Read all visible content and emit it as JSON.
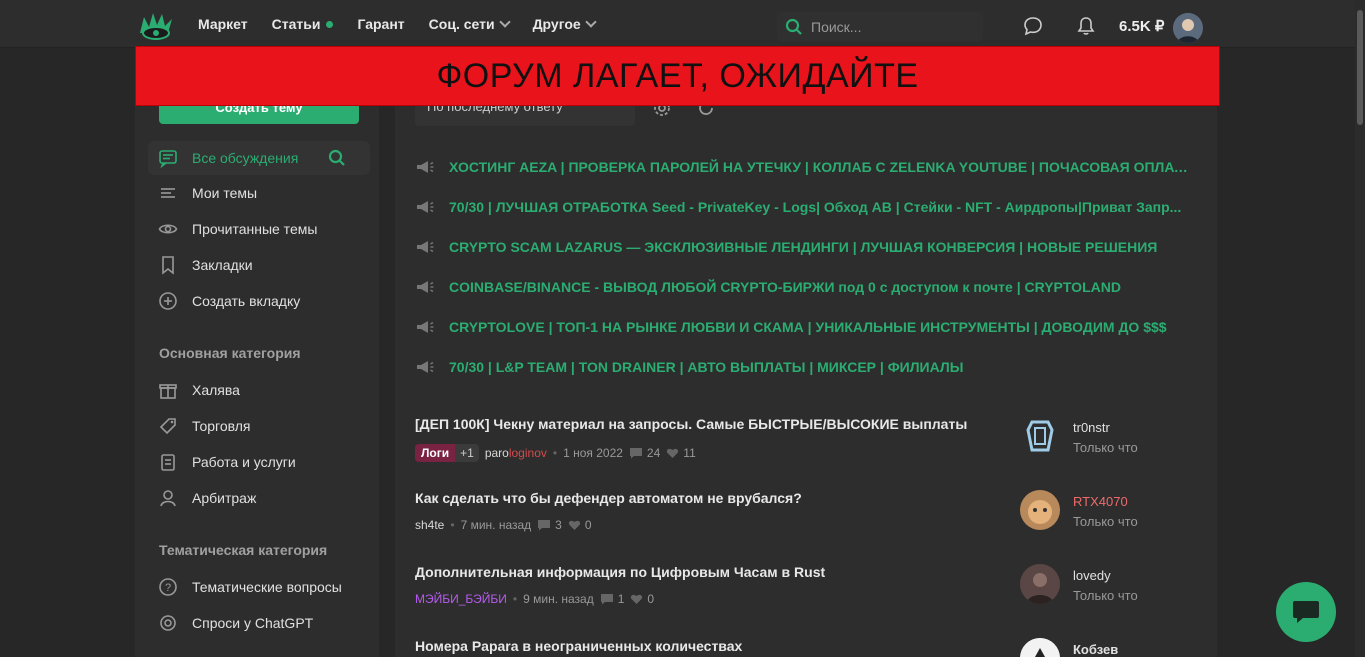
{
  "nav": {
    "items": [
      {
        "label": "Маркет"
      },
      {
        "label": "Статьи"
      },
      {
        "label": "Гарант"
      },
      {
        "label": "Соц. сети"
      },
      {
        "label": "Другое"
      }
    ],
    "search_placeholder": "Поиск...",
    "balance": "6.5K ₽"
  },
  "banner": {
    "text": "ФОРУМ ЛАГАЕТ, ОЖИДАЙТЕ"
  },
  "sidebar": {
    "create_button": "Создать тему",
    "items": [
      {
        "label": "Все обсуждения"
      },
      {
        "label": "Мои темы"
      },
      {
        "label": "Прочитанные темы"
      },
      {
        "label": "Закладки"
      },
      {
        "label": "Создать вкладку"
      }
    ],
    "section_main": "Основная категория",
    "main_items": [
      {
        "label": "Халява"
      },
      {
        "label": "Торговля"
      },
      {
        "label": "Работа и услуги"
      },
      {
        "label": "Арбитраж"
      }
    ],
    "section_thematic": "Тематическая категория",
    "thematic_items": [
      {
        "label": "Тематические вопросы"
      },
      {
        "label": "Спроси у ChatGPT"
      }
    ]
  },
  "main": {
    "sort_label": "По последнему ответу",
    "ads": [
      "ХОСТИНГ AEZA | ПРОВЕРКА ПАРОЛЕЙ НА УТЕЧКУ | КОЛЛАБ С ZELENKA YOUTUBE | ПОЧАСОВАЯ ОПЛАТА",
      "70/30 | ЛУЧШАЯ ОТРАБОТКА Seed - PrivateKey - Logs| Обход АВ | Стейки - NFT - Аирдропы|Приват Запр...",
      "CRYPTO SCAM LAZARUS — ЭКСКЛЮЗИВНЫЕ ЛЕНДИНГИ | ЛУЧШАЯ КОНВЕРСИЯ | НОВЫЕ РЕШЕНИЯ",
      "COINBASE/BINANCE - ВЫВОД ЛЮБОЙ CRYPTO-БИРЖИ под 0 с доступом к почте | CRYPTOLAND",
      "CRYPTOLOVE | ТОП-1 НА РЫНКЕ ЛЮБВИ И СКАМА | УНИКАЛЬНЫЕ ИНСТРУМЕНТЫ | ДОВОДИМ ДО $$$",
      "70/30 | L&P TEAM | TON DRAINER | АВТО ВЫПЛАТЫ | МИКСЕР | ФИЛИАЛЫ"
    ],
    "threads": [
      {
        "title": "[ДЕП 100К] Чекну материал на запросы. Самые БЫСТРЫЕ/ВЫСОКИЕ выплаты",
        "badge": "Логи",
        "badge_plus": "+1",
        "author_a": "paro",
        "author_b": "loginov",
        "time": "1 ноя 2022",
        "replies": "24",
        "likes": "11",
        "last_user": "tr0nstr",
        "last_time": "Только что"
      },
      {
        "title": "Как сделать что бы дефендер автоматом не врубался?",
        "author": "sh4te",
        "time": "7 мин. назад",
        "replies": "3",
        "likes": "0",
        "last_user": "RTX4070",
        "last_time": "Только что"
      },
      {
        "title": "Дополнительная информация по Цифровым Часам в Rust",
        "author": "МЭЙБИ_БЭЙБИ",
        "time": "9 мин. назад",
        "replies": "1",
        "likes": "0",
        "last_user": "lovedy",
        "last_time": "Только что"
      },
      {
        "title": "Номера Papara в неограниченных количествах",
        "last_user": "Кобзев"
      }
    ]
  },
  "colors": {
    "accent": "#2bad72",
    "banner": "#e8131b"
  }
}
